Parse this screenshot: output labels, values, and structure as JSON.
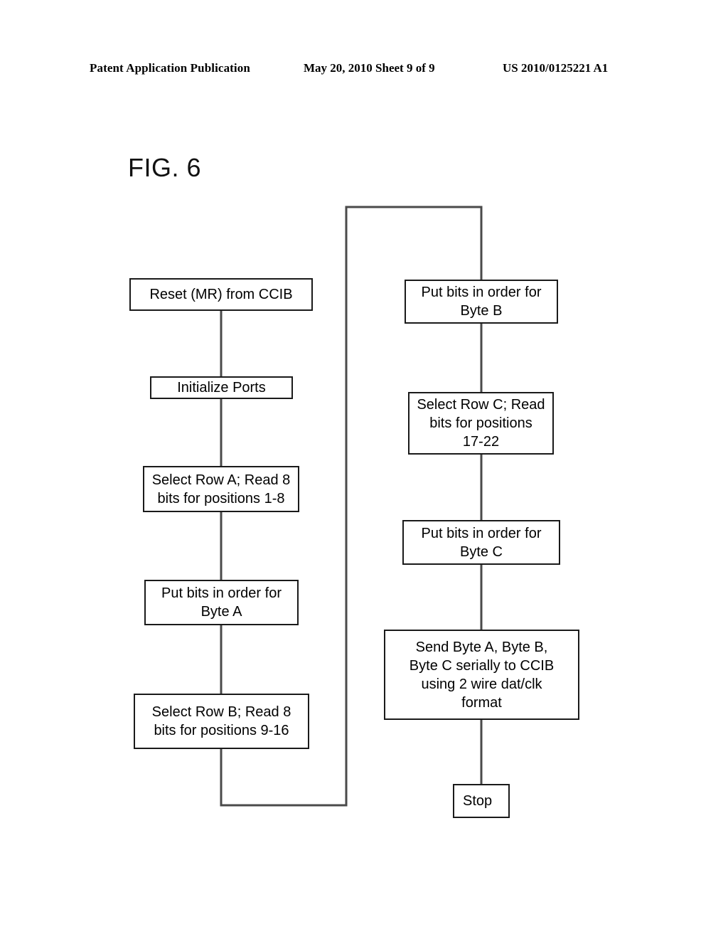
{
  "header": {
    "publication": "Patent Application Publication",
    "date_sheet": "May 20, 2010  Sheet 9 of 9",
    "patent_number": "US 2010/0125221 A1"
  },
  "figure": {
    "label": "FIG. 6",
    "line_color": "#4a4a4a",
    "box_border_color": "#1a1a1a",
    "background": "#ffffff"
  },
  "chart_data": {
    "type": "diagram",
    "title": "FIG. 6",
    "nodes": [
      {
        "id": "reset",
        "label": "Reset (MR) from CCIB",
        "column": "left"
      },
      {
        "id": "init",
        "label": "Initialize Ports",
        "column": "left"
      },
      {
        "id": "row_a",
        "label": "Select Row A; Read 8\nbits for positions 1-8",
        "column": "left"
      },
      {
        "id": "byte_a",
        "label": "Put bits in order for\nByte A",
        "column": "left"
      },
      {
        "id": "row_b",
        "label": "Select Row B; Read 8\nbits for positions 9-16",
        "column": "left"
      },
      {
        "id": "byte_b",
        "label": "Put bits in order for\nByte B",
        "column": "right"
      },
      {
        "id": "row_c",
        "label": "Select Row C; Read\nbits for positions\n17-22",
        "column": "right"
      },
      {
        "id": "byte_c",
        "label": "Put bits in order for\nByte C",
        "column": "right"
      },
      {
        "id": "send",
        "label": "Send Byte A, Byte B,\nByte C serially to CCIB\nusing 2 wire dat/clk\nformat",
        "column": "right"
      },
      {
        "id": "stop",
        "label": "Stop",
        "column": "right"
      }
    ],
    "edges": [
      {
        "from": "reset",
        "to": "init"
      },
      {
        "from": "init",
        "to": "row_a"
      },
      {
        "from": "row_a",
        "to": "byte_a"
      },
      {
        "from": "byte_a",
        "to": "row_b"
      },
      {
        "from": "row_b",
        "to": "byte_b"
      },
      {
        "from": "byte_b",
        "to": "row_c"
      },
      {
        "from": "row_c",
        "to": "byte_c"
      },
      {
        "from": "byte_c",
        "to": "send"
      },
      {
        "from": "send",
        "to": "stop"
      }
    ]
  }
}
